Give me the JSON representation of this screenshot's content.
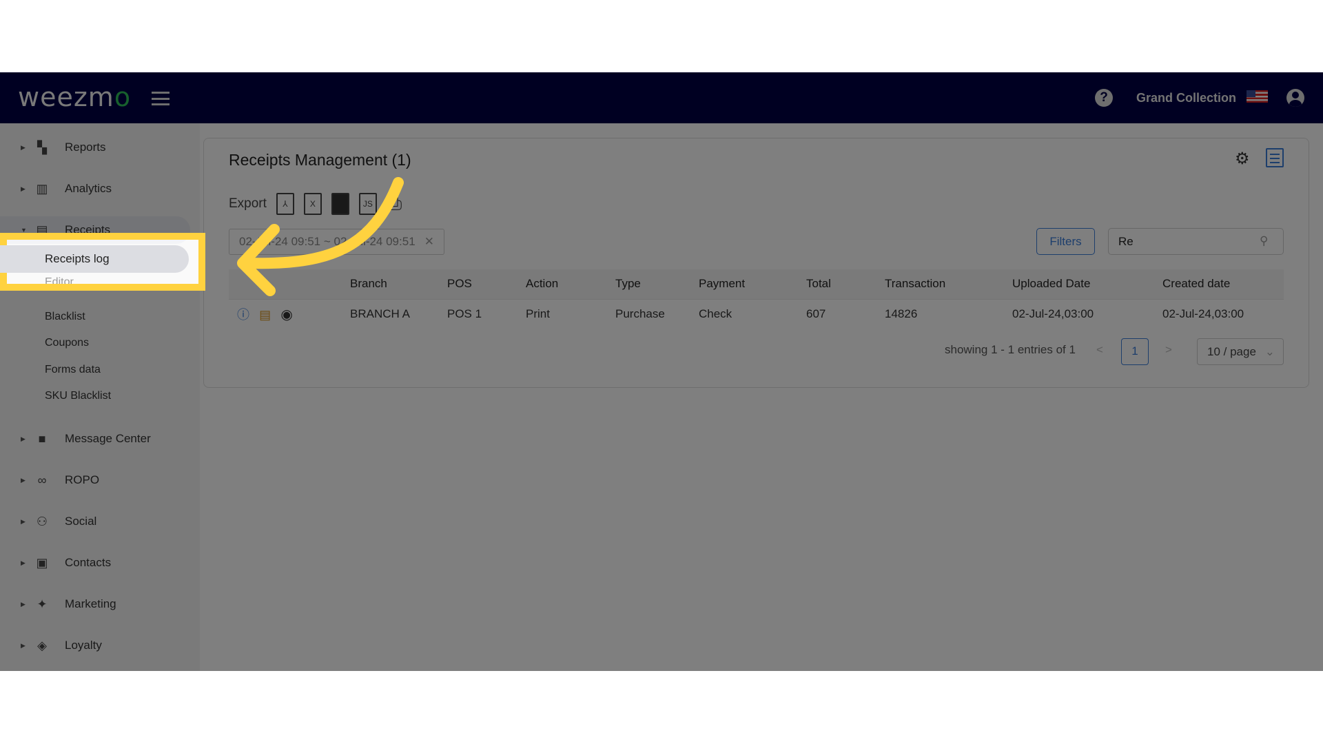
{
  "header": {
    "logo": "weezmo",
    "org": "Grand Collection"
  },
  "sidebar": {
    "items": [
      {
        "label": "Reports",
        "icon": "dashboard-icon"
      },
      {
        "label": "Analytics",
        "icon": "bar-chart-icon"
      },
      {
        "label": "Receipts",
        "icon": "receipt-icon",
        "open": true
      },
      {
        "label": "Message Center",
        "icon": "message-icon"
      },
      {
        "label": "ROPO",
        "icon": "infinity-icon"
      },
      {
        "label": "Social",
        "icon": "people-icon"
      },
      {
        "label": "Contacts",
        "icon": "contacts-icon"
      },
      {
        "label": "Marketing",
        "icon": "megaphone-icon"
      },
      {
        "label": "Loyalty",
        "icon": "tag-icon"
      }
    ],
    "sub": [
      "Receipts log",
      "Editor",
      "Blacklist",
      "Coupons",
      "Forms data",
      "SKU Blacklist"
    ]
  },
  "main": {
    "title": "Receipts Management (1)",
    "export_label": "Export",
    "date_filter": "02-Jul-24 09:51 ~ 02-Jul-24 09:51",
    "filters_label": "Filters",
    "search_value": "Re",
    "columns": [
      "",
      "Branch",
      "POS",
      "Action",
      "Type",
      "Payment",
      "Total",
      "Transaction",
      "Uploaded Date",
      "Created date"
    ],
    "rows": [
      [
        "BRANCH A",
        "POS 1",
        "Print",
        "Purchase",
        "Check",
        "607",
        "14826",
        "02-Jul-24,03:00",
        "02-Jul-24,03:00"
      ]
    ],
    "pagination": {
      "summary": "showing 1 - 1 entries of 1",
      "page": "1",
      "page_size": "10 / page"
    }
  },
  "colors": {
    "header": "#000045",
    "accent": "#3b7dd8",
    "highlight": "#ffd23f"
  }
}
